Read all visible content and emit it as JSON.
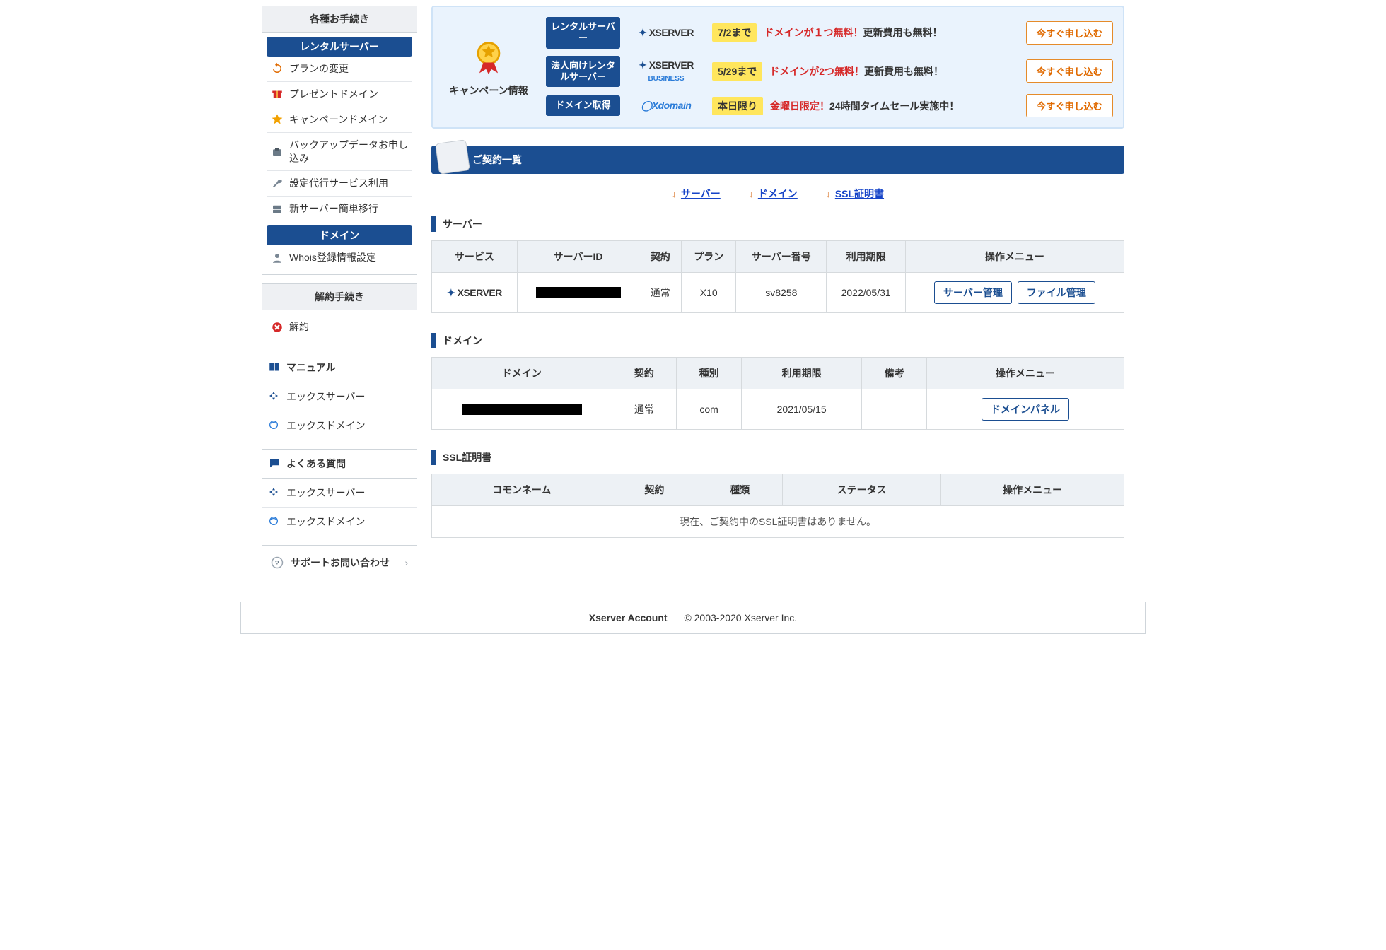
{
  "sidebar": {
    "procedures_title": "各種お手続き",
    "rental_server": {
      "heading": "レンタルサーバー",
      "items": [
        "プランの変更",
        "プレゼントドメイン",
        "キャンペーンドメイン",
        "バックアップデータお申し込み",
        "設定代行サービス利用",
        "新サーバー簡単移行"
      ]
    },
    "domain": {
      "heading": "ドメイン",
      "items": [
        "Whois登録情報設定"
      ]
    },
    "cancel_title": "解約手続き",
    "cancel_item": "解約",
    "manual": {
      "heading": "マニュアル",
      "items": [
        "エックスサーバー",
        "エックスドメイン"
      ]
    },
    "faq": {
      "heading": "よくある質問",
      "items": [
        "エックスサーバー",
        "エックスドメイン"
      ]
    },
    "support": "サポートお問い合わせ"
  },
  "campaign": {
    "label": "キャンペーン情報",
    "rows": [
      {
        "cat": "レンタルサーバー",
        "brand": "XSERVER",
        "brand_sub": "",
        "till": "7/2まで",
        "msg_red": "ドメインが１つ無料！",
        "msg_rest": "更新費用も無料！",
        "btn": "今すぐ申し込む"
      },
      {
        "cat": "法人向けレンタルサーバー",
        "brand": "XSERVER",
        "brand_sub": "BUSINESS",
        "till": "5/29まで",
        "msg_red": "ドメインが2つ無料！",
        "msg_rest": "更新費用も無料！",
        "btn": "今すぐ申し込む"
      },
      {
        "cat": "ドメイン取得",
        "brand": "Xdomain",
        "brand_sub": "",
        "till": "本日限り",
        "msg_red": "金曜日限定！",
        "msg_rest": "24時間タイムセール実施中！",
        "btn": "今すぐ申し込む"
      }
    ]
  },
  "contracts_heading": "ご契約一覧",
  "anchors": {
    "server": "サーバー",
    "domain": "ドメイン",
    "ssl": "SSL証明書"
  },
  "server_section": {
    "title": "サーバー",
    "headers": [
      "サービス",
      "サーバーID",
      "契約",
      "プラン",
      "サーバー番号",
      "利用期限",
      "操作メニュー"
    ],
    "row": {
      "service": "XSERVER",
      "contract": "通常",
      "plan": "X10",
      "server_no": "sv8258",
      "expire": "2022/05/31",
      "btn1": "サーバー管理",
      "btn2": "ファイル管理"
    }
  },
  "domain_section": {
    "title": "ドメイン",
    "headers": [
      "ドメイン",
      "契約",
      "種別",
      "利用期限",
      "備考",
      "操作メニュー"
    ],
    "row": {
      "contract": "通常",
      "type": "com",
      "expire": "2021/05/15",
      "note": "",
      "btn": "ドメインパネル"
    }
  },
  "ssl_section": {
    "title": "SSL証明書",
    "headers": [
      "コモンネーム",
      "契約",
      "種類",
      "ステータス",
      "操作メニュー"
    ],
    "empty": "現在、ご契約中のSSL証明書はありません。"
  },
  "footer": {
    "account": "Xserver Account",
    "copy": "© 2003-2020 Xserver Inc."
  }
}
